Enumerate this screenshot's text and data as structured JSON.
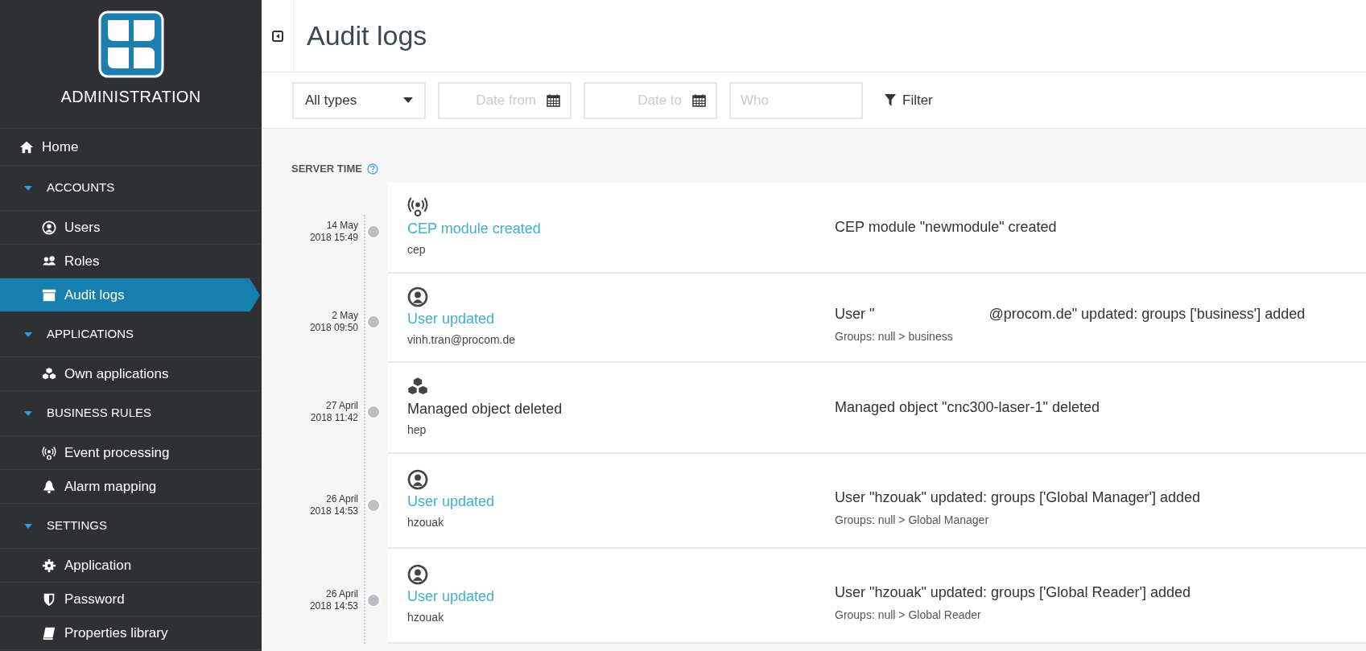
{
  "sidebar": {
    "title": "ADMINISTRATION",
    "items": [
      {
        "label": "Home",
        "selected": false
      },
      {
        "label": "ACCOUNTS",
        "expanded": true,
        "children": [
          {
            "label": "Users",
            "selected": false
          },
          {
            "label": "Roles",
            "selected": false
          },
          {
            "label": "Audit logs",
            "selected": true
          }
        ]
      },
      {
        "label": "APPLICATIONS",
        "expanded": true,
        "children": [
          {
            "label": "Own applications",
            "selected": false
          }
        ]
      },
      {
        "label": "BUSINESS RULES",
        "expanded": true,
        "children": [
          {
            "label": "Event processing",
            "selected": false
          },
          {
            "label": "Alarm mapping",
            "selected": false
          }
        ]
      },
      {
        "label": "SETTINGS",
        "expanded": true,
        "children": [
          {
            "label": "Application",
            "selected": false
          },
          {
            "label": "Password",
            "selected": false
          },
          {
            "label": "Properties library",
            "selected": false
          }
        ]
      }
    ]
  },
  "header": {
    "title": "Audit logs"
  },
  "filters": {
    "type_select": "All types",
    "date_from": {
      "placeholder": "Date from"
    },
    "date_to": {
      "placeholder": "Date to"
    },
    "who": {
      "placeholder": "Who"
    },
    "filter_button": "Filter"
  },
  "timeline": {
    "heading": "SERVER TIME",
    "entries": [
      {
        "date": "14 May",
        "time": "2018 15:49",
        "title": "CEP module created",
        "link": true,
        "user": "cep",
        "description": [
          "CEP module \"newmodule\" created"
        ]
      },
      {
        "date": "2 May",
        "time": "2018 09:50",
        "title": "User updated",
        "link": true,
        "user": "vinh.tran@procom.de",
        "description": [
          "User \"",
          "@procom.de\" updated: groups ['business'] added"
        ],
        "detail": "Groups: null > business"
      },
      {
        "date": "27 April",
        "time": "2018 11:42",
        "title": "Managed object deleted",
        "link": false,
        "user": "hep",
        "description": [
          "Managed object \"cnc300-laser-1\" deleted"
        ]
      },
      {
        "date": "26 April",
        "time": "2018 14:53",
        "title": "User updated",
        "link": true,
        "user": "hzouak",
        "description": [
          "User \"hzouak\" updated: groups ['Global Manager'] added"
        ],
        "detail": "Groups: null > Global Manager"
      },
      {
        "date": "26 April",
        "time": "2018 14:53",
        "title": "User updated",
        "link": true,
        "user": "hzouak",
        "description": [
          "User \"hzouak\" updated: groups ['Global Reader'] added"
        ],
        "detail": "Groups: null > Global Reader"
      }
    ]
  }
}
